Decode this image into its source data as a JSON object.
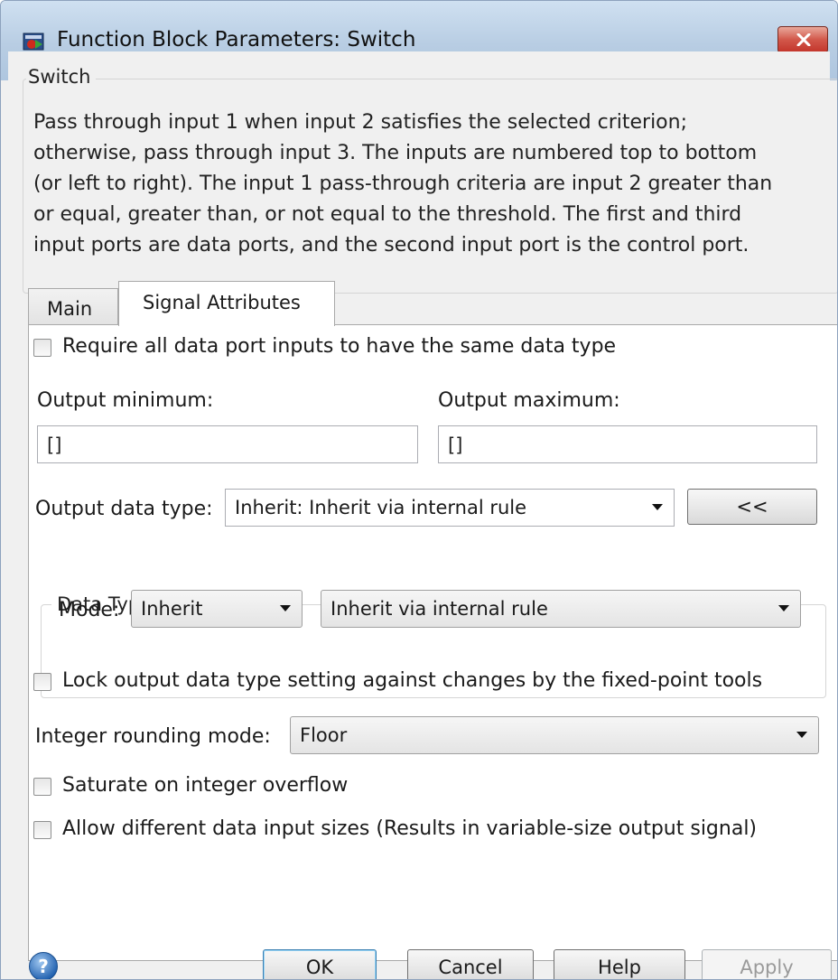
{
  "window": {
    "title": "Function Block Parameters: Switch"
  },
  "description": {
    "group_label": "Switch",
    "lines": [
      "Pass through input 1 when input 2 satisfies the selected criterion;",
      "otherwise, pass through input 3.  The inputs are numbered top to bottom",
      "(or left to right). The input 1 pass-through criteria are input 2 greater than",
      "or equal, greater than, or not equal to the threshold.  The first and third",
      "input ports are data ports, and the second input port is the control port."
    ]
  },
  "tabs": [
    {
      "label": "Main",
      "selected": false
    },
    {
      "label": "Signal Attributes",
      "selected": true
    }
  ],
  "signal_attributes": {
    "require_same_type": {
      "label": "Require all data port inputs to have the same data type",
      "checked": false
    },
    "output_minimum": {
      "label": "Output minimum:",
      "value": "[]"
    },
    "output_maximum": {
      "label": "Output maximum:",
      "value": "[]"
    },
    "output_data_type": {
      "label": "Output data type:",
      "value": "Inherit: Inherit via internal rule",
      "toggle_button": "<<"
    },
    "data_type_assistant": {
      "label": "Data Type Assistant",
      "mode_label": "Mode:",
      "mode_value": "Inherit",
      "rule_value": "Inherit via internal rule"
    },
    "lock_output": {
      "label": "Lock output data type setting against changes by the fixed-point tools",
      "checked": false
    },
    "integer_rounding": {
      "label": "Integer rounding mode:",
      "value": "Floor"
    },
    "saturate": {
      "label": "Saturate on integer overflow",
      "checked": false
    },
    "allow_different_sizes": {
      "label": "Allow different data input sizes (Results in variable-size output signal)",
      "checked": false
    }
  },
  "footer": {
    "ok": "OK",
    "cancel": "Cancel",
    "help": "Help",
    "apply": "Apply"
  },
  "colors": {
    "titlebar": "#b8cde3",
    "close": "#c2342a",
    "dialog_bg": "#f0f0f0",
    "panel_bg": "#ffffff"
  },
  "icons": [
    "simulink-block-icon",
    "close-icon",
    "help-icon",
    "chevron-down-icon"
  ]
}
